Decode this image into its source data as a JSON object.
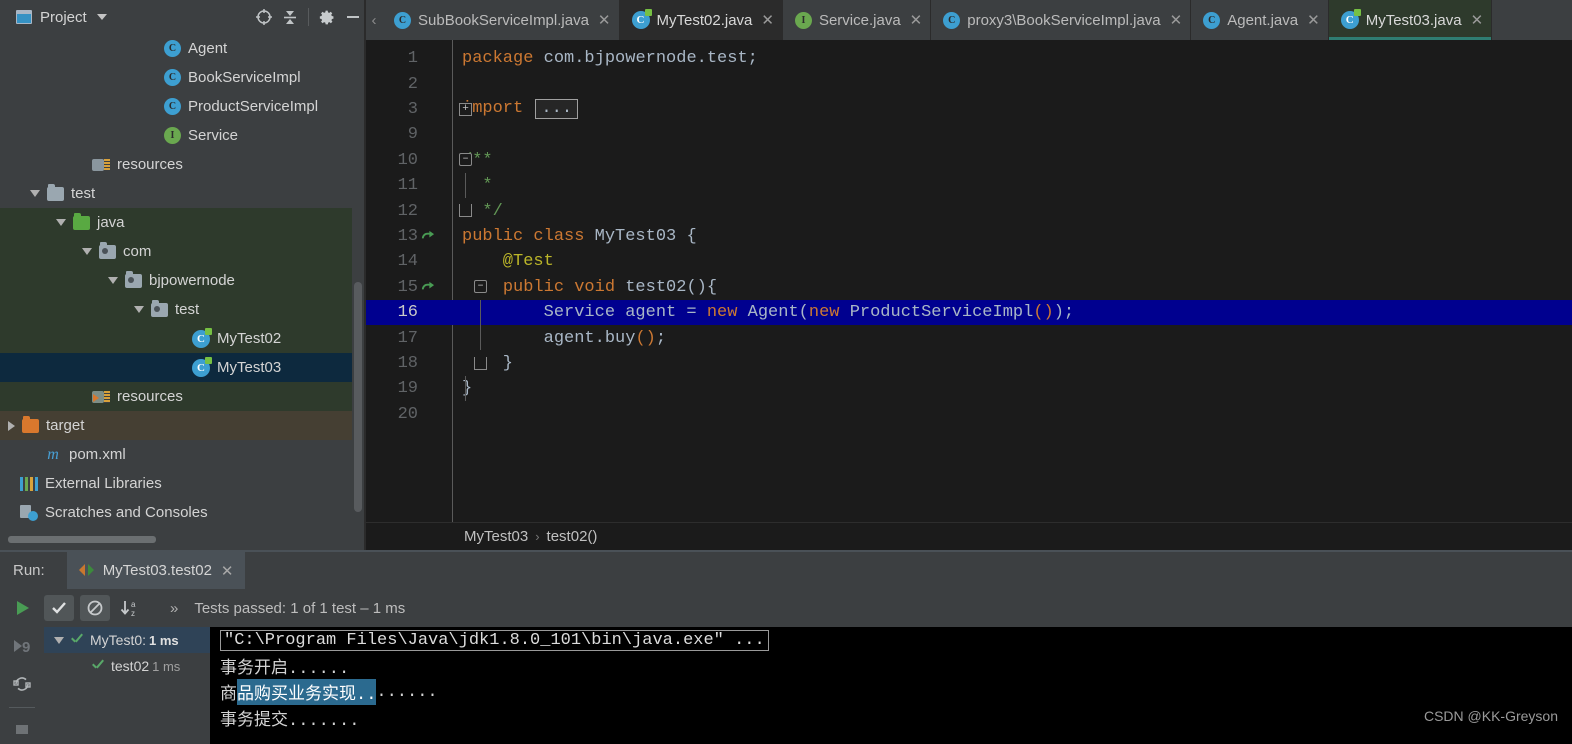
{
  "project_panel": {
    "title": "Project",
    "icons": [
      "window-icon",
      "chevron-down-icon",
      "locate-target-icon",
      "collapse-all-icon",
      "settings-gear-icon",
      "minimize-icon"
    ],
    "tree": [
      {
        "label": "Agent",
        "icon": "class-icon",
        "indent": 150,
        "twisty": "none",
        "state": "normal"
      },
      {
        "label": "BookServiceImpl",
        "icon": "class-icon",
        "indent": 150,
        "twisty": "none",
        "state": "normal"
      },
      {
        "label": "ProductServiceImpl",
        "icon": "class-icon",
        "indent": 150,
        "twisty": "none",
        "state": "normal"
      },
      {
        "label": "Service",
        "icon": "interface-icon",
        "indent": 150,
        "twisty": "none",
        "state": "normal"
      },
      {
        "label": "resources",
        "icon": "resources-folder-icon",
        "indent": 78,
        "twisty": "none",
        "state": "normal"
      },
      {
        "label": "test",
        "icon": "folder-icon",
        "indent": 30,
        "twisty": "open",
        "state": "normal"
      },
      {
        "label": "java",
        "icon": "source-folder-icon",
        "indent": 56,
        "twisty": "open",
        "state": "test-root"
      },
      {
        "label": "com",
        "icon": "package-icon",
        "indent": 82,
        "twisty": "open",
        "state": "test-root"
      },
      {
        "label": "bjpowernode",
        "icon": "package-icon",
        "indent": 108,
        "twisty": "open",
        "state": "test-root"
      },
      {
        "label": "test",
        "icon": "package-icon",
        "indent": 134,
        "twisty": "open",
        "state": "test-root"
      },
      {
        "label": "MyTest02",
        "icon": "test-class-icon",
        "indent": 178,
        "twisty": "none",
        "state": "test-root"
      },
      {
        "label": "MyTest03",
        "icon": "test-class-icon",
        "indent": 178,
        "twisty": "none",
        "state": "selected"
      },
      {
        "label": "resources",
        "icon": "generated-resources-icon",
        "indent": 78,
        "twisty": "none",
        "state": "test-root"
      },
      {
        "label": "target",
        "icon": "target-folder-icon",
        "indent": 8,
        "twisty": "closed",
        "state": "target"
      },
      {
        "label": "pom.xml",
        "icon": "maven-icon",
        "indent": 30,
        "twisty": "none",
        "state": "normal"
      },
      {
        "label": "External Libraries",
        "icon": "libraries-icon",
        "indent": 6,
        "twisty": "none",
        "state": "normal"
      },
      {
        "label": "Scratches and Consoles",
        "icon": "scratches-icon",
        "indent": 6,
        "twisty": "none",
        "state": "normal"
      }
    ]
  },
  "editor_tabs": {
    "scroll_left_glyph": "‹",
    "close_glyph": "✕",
    "tabs": [
      {
        "label": "SubBookServiceImpl.java",
        "icon": "class-icon",
        "active": false,
        "closeable": true
      },
      {
        "label": "MyTest02.java",
        "icon": "test-class-icon",
        "active": true,
        "closeable": true
      },
      {
        "label": "Service.java",
        "icon": "interface-icon",
        "active": false,
        "closeable": true
      },
      {
        "label": "proxy3\\BookServiceImpl.java",
        "icon": "class-icon",
        "active": false,
        "closeable": true
      },
      {
        "label": "Agent.java",
        "icon": "class-icon",
        "active": false,
        "closeable": true
      },
      {
        "label": "MyTest03.java",
        "icon": "test-class-icon",
        "active": "current",
        "closeable": true
      }
    ]
  },
  "editor": {
    "lines": [
      {
        "num": "1",
        "fold": "none",
        "run": false,
        "highlight": false,
        "segments": [
          {
            "t": "package ",
            "c": "k"
          },
          {
            "t": "com.bjpowernode.test;",
            "c": "id"
          }
        ]
      },
      {
        "num": "2",
        "fold": "none",
        "run": false,
        "highlight": false,
        "segments": []
      },
      {
        "num": "3",
        "fold": "plus",
        "run": false,
        "highlight": false,
        "import_fold": true,
        "segments": [
          {
            "t": "import ",
            "c": "k"
          }
        ],
        "fold_placeholder": "..."
      },
      {
        "num": "9",
        "fold": "none",
        "run": false,
        "highlight": false,
        "segments": []
      },
      {
        "num": "10",
        "fold": "minus",
        "run": false,
        "highlight": false,
        "segments": [
          {
            "t": "/**",
            "c": "cm"
          }
        ]
      },
      {
        "num": "11",
        "fold": "bar",
        "run": false,
        "highlight": false,
        "segments": [
          {
            "t": "  *",
            "c": "cm"
          }
        ]
      },
      {
        "num": "12",
        "fold": "end",
        "run": false,
        "highlight": false,
        "segments": [
          {
            "t": "  */",
            "c": "cm"
          }
        ]
      },
      {
        "num": "13",
        "fold": "none",
        "run": true,
        "highlight": false,
        "segments": [
          {
            "t": "public class ",
            "c": "k"
          },
          {
            "t": "MyTest03 ",
            "c": "ty"
          },
          {
            "t": "{",
            "c": "id"
          }
        ]
      },
      {
        "num": "14",
        "fold": "none",
        "run": false,
        "highlight": false,
        "segments": [
          {
            "t": "    @Test",
            "c": "an"
          }
        ]
      },
      {
        "num": "15",
        "fold": "minus2",
        "run": true,
        "highlight": false,
        "segments": [
          {
            "t": "    ",
            "c": "id"
          },
          {
            "t": "public void ",
            "c": "k"
          },
          {
            "t": "test02",
            "c": "ty"
          },
          {
            "t": "(){",
            "c": "id"
          }
        ]
      },
      {
        "num": "16",
        "fold": "bar2",
        "run": false,
        "highlight": true,
        "segments": [
          {
            "t": "        Service agent = ",
            "c": "id"
          },
          {
            "t": "new ",
            "c": "k"
          },
          {
            "t": "Agent(",
            "c": "id"
          },
          {
            "t": "new ",
            "c": "k"
          },
          {
            "t": "ProductServiceImpl",
            "c": "id"
          },
          {
            "t": "()",
            "c": "paren"
          },
          {
            "t": ");",
            "c": "id"
          }
        ]
      },
      {
        "num": "17",
        "fold": "bar2",
        "run": false,
        "highlight": false,
        "segments": [
          {
            "t": "        agent.buy",
            "c": "id"
          },
          {
            "t": "()",
            "c": "paren"
          },
          {
            "t": ";",
            "c": "id"
          }
        ]
      },
      {
        "num": "18",
        "fold": "end2",
        "run": false,
        "highlight": false,
        "segments": [
          {
            "t": "    }",
            "c": "id"
          }
        ]
      },
      {
        "num": "19",
        "fold": "bar",
        "run": false,
        "highlight": false,
        "segments": [
          {
            "t": "}",
            "c": "id"
          }
        ]
      },
      {
        "num": "20",
        "fold": "none",
        "run": false,
        "highlight": false,
        "segments": []
      }
    ]
  },
  "breadcrumb": {
    "class": "MyTest03",
    "separator": "›",
    "method": "test02()"
  },
  "run_panel": {
    "run_label": "Run:",
    "tab_label": "MyTest03.test02",
    "tab_close_glyph": "✕",
    "side_icons": [
      "rerun-icon",
      "rerun-failed-icon",
      "toggle-auto-test-icon",
      "stop-icon"
    ],
    "toolbar_icons": [
      "show-passed-icon",
      "hide-ignored-icon",
      "sort-alphabetically-icon",
      "expand-output-icon"
    ],
    "status": "Tests passed: 1 of 1 test – 1 ms",
    "test_tree": [
      {
        "label": "MyTest0:",
        "time": "1 ms",
        "twisty": "open",
        "selected": true,
        "indent": 10
      },
      {
        "label": "test02",
        "time": "1 ms",
        "twisty": "none",
        "selected": false,
        "indent": 34
      }
    ],
    "console": [
      {
        "type": "command",
        "text": "\"C:\\Program Files\\Java\\jdk1.8.0_101\\bin\\java.exe\" ..."
      },
      {
        "type": "plain",
        "text": "事务开启......"
      },
      {
        "type": "selection",
        "prefix": "商",
        "selected": "品购买业务实现..",
        "suffix": "......"
      },
      {
        "type": "plain",
        "text": "事务提交......."
      }
    ]
  },
  "watermark": "CSDN @KK-Greyson",
  "colors": {
    "panel_bg": "#3c3f41",
    "editor_bg": "#1b1b1b",
    "console_bg": "#000000",
    "selection_blue": "#00008f",
    "tree_selection": "#0d293e",
    "test_source_root": "#2e3a2c",
    "target_folder": "#453f33",
    "accent_green": "#59a869",
    "keyword_orange": "#cc7832",
    "comment_green": "#629755",
    "annotation_yellow": "#bbb529"
  }
}
